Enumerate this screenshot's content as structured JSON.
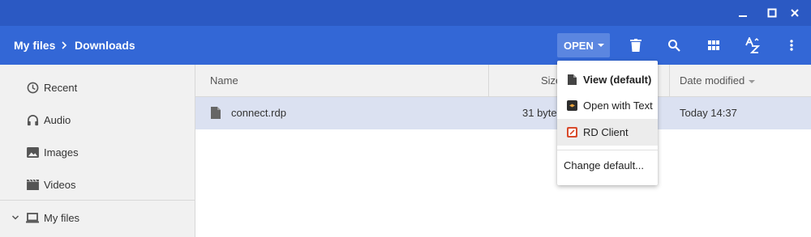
{
  "window": {
    "controls": [
      "minimize-icon",
      "maximize-icon",
      "close-icon"
    ],
    "colors": {
      "titlebar": "#2b59c3",
      "toolbar": "#3367d6",
      "selection": "#dbe1f1"
    }
  },
  "breadcrumb": {
    "root": "My files",
    "current": "Downloads"
  },
  "toolbar": {
    "open_label": "OPEN",
    "icons": [
      "delete-icon",
      "search-icon",
      "grid-view-icon",
      "sort-az-icon",
      "more-vert-icon"
    ]
  },
  "sidebar": {
    "items": [
      {
        "label": "Recent",
        "icon": "clock-icon"
      },
      {
        "label": "Audio",
        "icon": "headphones-icon"
      },
      {
        "label": "Images",
        "icon": "image-icon"
      },
      {
        "label": "Videos",
        "icon": "video-icon"
      }
    ],
    "my_files": {
      "label": "My files",
      "icon": "laptop-icon",
      "expanded": true
    }
  },
  "file_list": {
    "columns": {
      "name": "Name",
      "size": "Size",
      "date": "Date modified"
    },
    "rows": [
      {
        "name": "connect.rdp",
        "size": "31 bytes",
        "date": "Today 14:37",
        "selected": true
      }
    ]
  },
  "open_menu": {
    "items": [
      {
        "label": "View (default)",
        "bold": true,
        "icon": "file-icon"
      },
      {
        "label": "Open with Text",
        "bold": false,
        "icon": "text-app-icon"
      },
      {
        "label": "RD Client",
        "bold": false,
        "icon": "rd-client-icon",
        "highlighted": true
      }
    ],
    "change_default": "Change default..."
  }
}
